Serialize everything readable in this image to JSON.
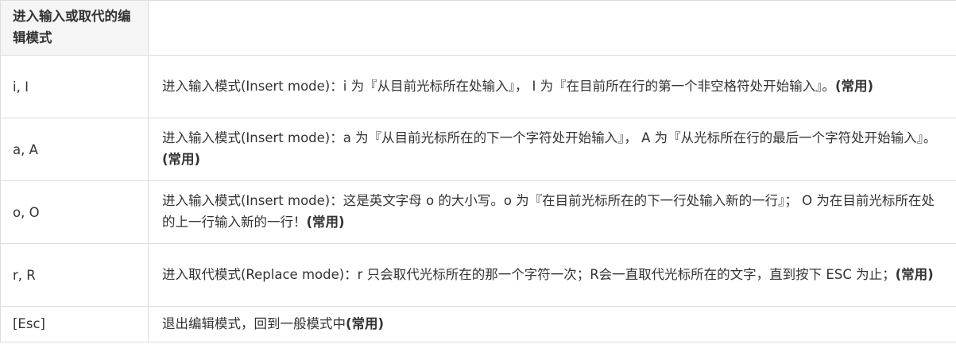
{
  "header": {
    "col1": "进入输入或取代的编辑模式",
    "col2": ""
  },
  "rows": [
    {
      "key": "i, I",
      "desc": "进入输入模式(Insert mode)：i 为『从目前光标所在处输入』， I 为『在目前所在行的第一个非空格符处开始输入』。",
      "tag": "(常用)"
    },
    {
      "key": "a, A",
      "desc": "进入输入模式(Insert mode)：a 为『从目前光标所在的下一个字符处开始输入』， A 为『从光标所在行的最后一个字符处开始输入』。",
      "tag": "(常用)"
    },
    {
      "key": "o, O",
      "desc": "进入输入模式(Insert mode)：这是英文字母 o 的大小写。o 为『在目前光标所在的下一行处输入新的一行』； O 为在目前光标所在处的上一行输入新的一行！",
      "tag": "(常用)"
    },
    {
      "key": "r, R",
      "desc": "进入取代模式(Replace mode)：r 只会取代光标所在的那一个字符一次；R会一直取代光标所在的文字，直到按下 ESC 为止；",
      "tag": "(常用)"
    },
    {
      "key": "[Esc]",
      "desc": "退出编辑模式，回到一般模式中",
      "tag": "(常用)"
    }
  ]
}
